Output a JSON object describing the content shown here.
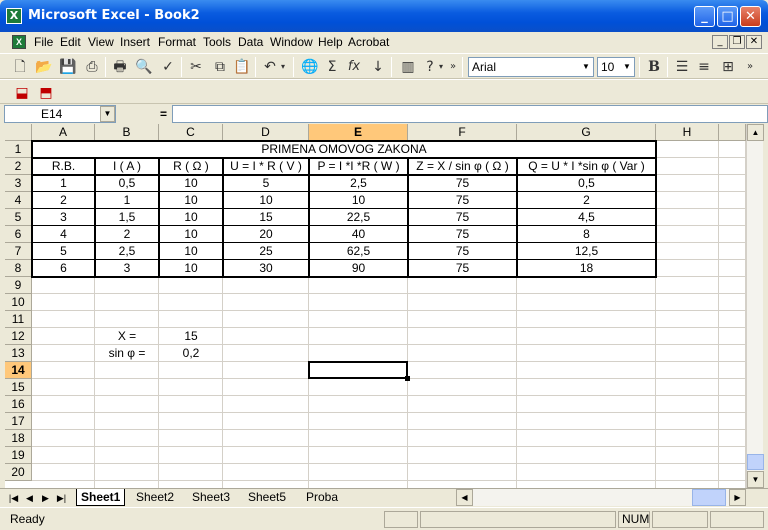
{
  "window": {
    "title": "Microsoft Excel - Book2",
    "app_icon": "X"
  },
  "menu": [
    "File",
    "Edit",
    "View",
    "Insert",
    "Format",
    "Tools",
    "Data",
    "Window",
    "Help",
    "Acrobat"
  ],
  "font": {
    "name": "Arial",
    "size": "10"
  },
  "formula_bar": {
    "cell_ref": "E14",
    "equals": "=",
    "value": ""
  },
  "columns": [
    "A",
    "B",
    "C",
    "D",
    "E",
    "F",
    "G",
    "H"
  ],
  "rows": [
    "1",
    "2",
    "3",
    "4",
    "5",
    "6",
    "7",
    "8",
    "9",
    "10",
    "11",
    "12",
    "13",
    "14",
    "15",
    "16",
    "17",
    "18",
    "19",
    "20"
  ],
  "active_column": "E",
  "active_row": "14",
  "table": {
    "title": "PRIMENA OMOVOG ZAKONA",
    "headers": [
      "R.B.",
      "I ( A )",
      "R ( Ω )",
      "U = I * R ( V )",
      "P = I *I *R ( W )",
      "Z = X / sin φ ( Ω )",
      "Q = U * I *sin φ ( Var )"
    ],
    "rows": [
      [
        "1",
        "0,5",
        "10",
        "5",
        "2,5",
        "75",
        "0,5"
      ],
      [
        "2",
        "1",
        "10",
        "10",
        "10",
        "75",
        "2"
      ],
      [
        "3",
        "1,5",
        "10",
        "15",
        "22,5",
        "75",
        "4,5"
      ],
      [
        "4",
        "2",
        "10",
        "20",
        "40",
        "75",
        "8"
      ],
      [
        "5",
        "2,5",
        "10",
        "25",
        "62,5",
        "75",
        "12,5"
      ],
      [
        "6",
        "3",
        "10",
        "30",
        "90",
        "75",
        "18"
      ]
    ]
  },
  "params": [
    {
      "label": "X =",
      "value": "15"
    },
    {
      "label": "sin φ =",
      "value": "0,2"
    }
  ],
  "sheets": [
    "Sheet1",
    "Sheet2",
    "Sheet3",
    "Sheet5",
    "Proba"
  ],
  "active_sheet": "Sheet1",
  "status": {
    "text": "Ready",
    "num": "NUM"
  }
}
